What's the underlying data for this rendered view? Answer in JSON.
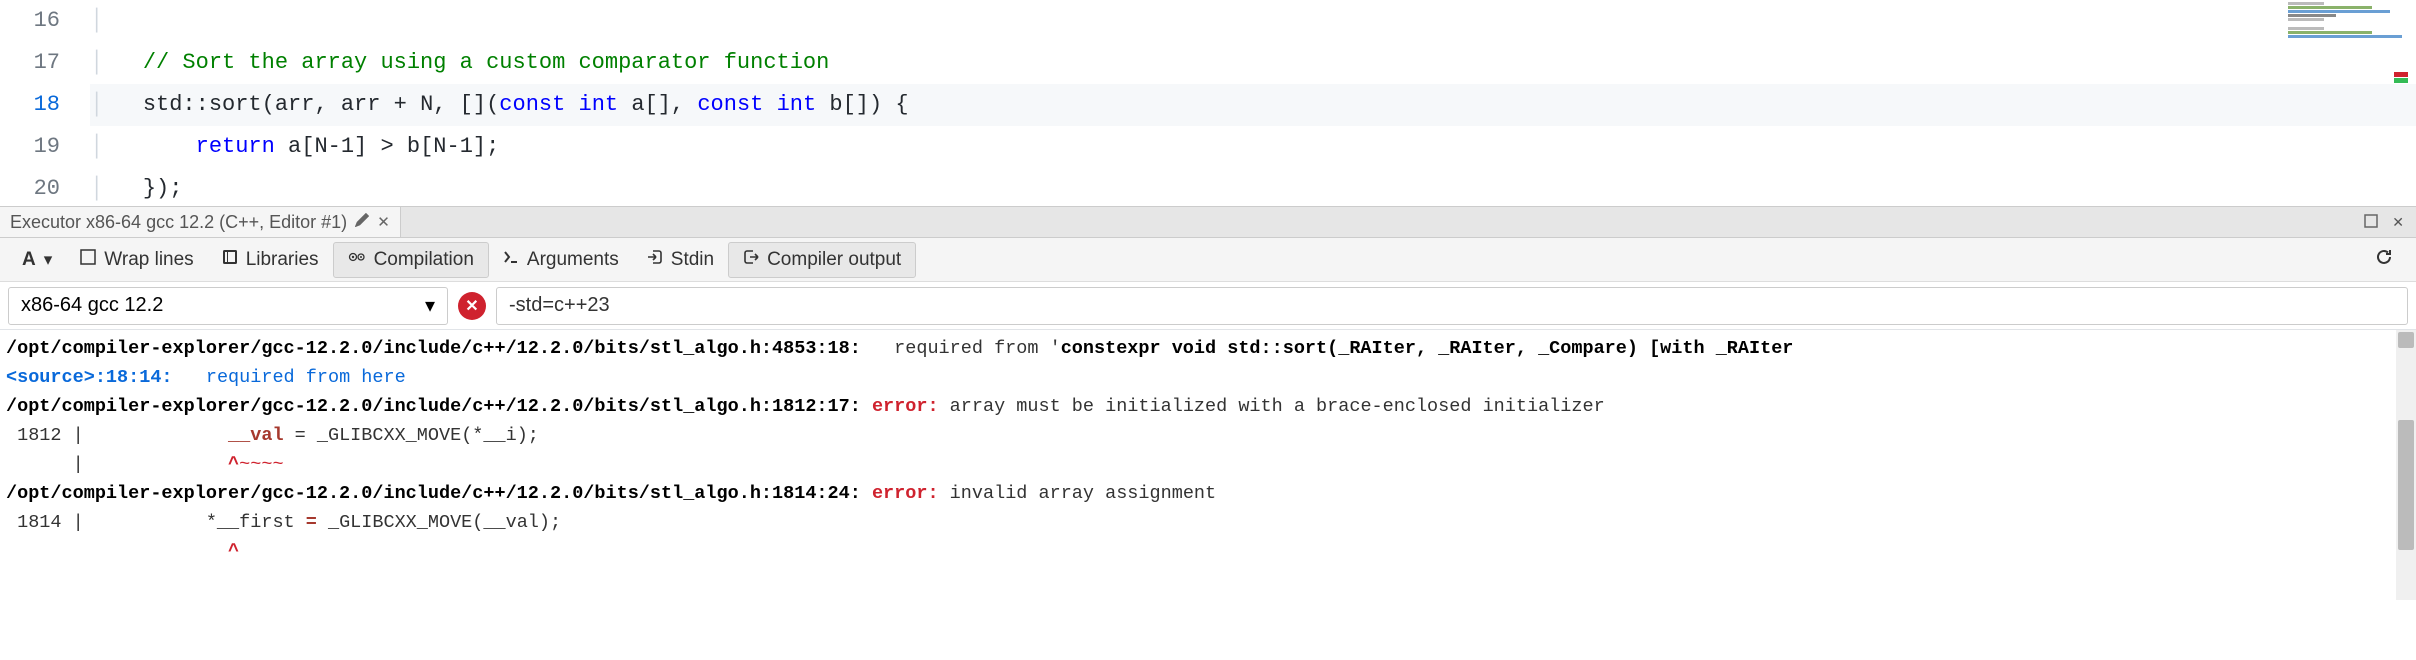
{
  "editor": {
    "line_numbers": [
      "16",
      "17",
      "18",
      "19",
      "20"
    ],
    "current_line_index": 2,
    "lines_tokens": [
      [
        {
          "t": "indent",
          "v": "│       "
        }
      ],
      [
        {
          "t": "indent",
          "v": "│   "
        },
        {
          "t": "comment",
          "v": "// Sort the array using a custom comparator function"
        }
      ],
      [
        {
          "t": "indent",
          "v": "│   "
        },
        {
          "t": "ident",
          "v": "std"
        },
        {
          "t": "punct",
          "v": "::"
        },
        {
          "t": "ident",
          "v": "sort"
        },
        {
          "t": "punct",
          "v": "("
        },
        {
          "t": "ident",
          "v": "arr"
        },
        {
          "t": "punct",
          "v": ", "
        },
        {
          "t": "ident",
          "v": "arr "
        },
        {
          "t": "punct",
          "v": "+ "
        },
        {
          "t": "ident",
          "v": "N"
        },
        {
          "t": "punct",
          "v": ", []("
        },
        {
          "t": "keyword",
          "v": "const"
        },
        {
          "t": "punct",
          "v": " "
        },
        {
          "t": "keyword",
          "v": "int"
        },
        {
          "t": "punct",
          "v": " a[], "
        },
        {
          "t": "keyword",
          "v": "const"
        },
        {
          "t": "punct",
          "v": " "
        },
        {
          "t": "keyword",
          "v": "int"
        },
        {
          "t": "punct",
          "v": " b[]) {"
        }
      ],
      [
        {
          "t": "indent",
          "v": "│       "
        },
        {
          "t": "keyword",
          "v": "return"
        },
        {
          "t": "punct",
          "v": " a[N"
        },
        {
          "t": "punct",
          "v": "-"
        },
        {
          "t": "punct",
          "v": "1] > b[N"
        },
        {
          "t": "punct",
          "v": "-"
        },
        {
          "t": "punct",
          "v": "1];"
        }
      ],
      [
        {
          "t": "indent",
          "v": "│   "
        },
        {
          "t": "punct",
          "v": "});"
        }
      ]
    ]
  },
  "panel_tab": {
    "title": "Executor x86-64 gcc 12.2 (C++, Editor #1)"
  },
  "toolbar": {
    "font_label": "A",
    "wrap_label": "Wrap lines",
    "libraries_label": "Libraries",
    "compilation_label": "Compilation",
    "arguments_label": "Arguments",
    "stdin_label": "Stdin",
    "compiler_output_label": "Compiler output"
  },
  "compiler": {
    "selected": "x86-64 gcc 12.2",
    "status_icon": "✕",
    "flags": "-std=c++23"
  },
  "output": {
    "lines": [
      {
        "segs": [
          {
            "c": "path",
            "v": "/opt/compiler-explorer/gcc-12.2.0/include/c++/12.2.0/bits/stl_algo.h:4853:18:"
          },
          {
            "c": "plain",
            "v": "   required from '"
          },
          {
            "c": "path",
            "v": "constexpr void std::sort(_RAIter, _RAIter, _Compare) [with _RAIter"
          }
        ]
      },
      {
        "segs": [
          {
            "c": "src",
            "v": "<source>:18:14:"
          },
          {
            "c": "plain",
            "v": "   "
          },
          {
            "c": "note",
            "v": "required from here"
          }
        ]
      },
      {
        "segs": [
          {
            "c": "path",
            "v": "/opt/compiler-explorer/gcc-12.2.0/include/c++/12.2.0/bits/stl_algo.h:1812:17:"
          },
          {
            "c": "plain",
            "v": " "
          },
          {
            "c": "err",
            "v": "error:"
          },
          {
            "c": "plain",
            "v": " array must be initialized with a brace-enclosed initializer"
          }
        ]
      },
      {
        "segs": [
          {
            "c": "plain",
            "v": " 1812 |             "
          },
          {
            "c": "var",
            "v": "__val"
          },
          {
            "c": "plain",
            "v": " = _GLIBCXX_MOVE(*__i);"
          }
        ]
      },
      {
        "segs": [
          {
            "c": "plain",
            "v": "      |             "
          },
          {
            "c": "caret",
            "v": "^"
          },
          {
            "c": "tilde",
            "v": "~~~~"
          }
        ]
      },
      {
        "segs": [
          {
            "c": "path",
            "v": "/opt/compiler-explorer/gcc-12.2.0/include/c++/12.2.0/bits/stl_algo.h:1814:24:"
          },
          {
            "c": "plain",
            "v": " "
          },
          {
            "c": "err",
            "v": "error:"
          },
          {
            "c": "plain",
            "v": " invalid array assignment"
          }
        ]
      },
      {
        "segs": [
          {
            "c": "plain",
            "v": " 1814 |           *__first "
          },
          {
            "c": "var",
            "v": "="
          },
          {
            "c": "plain",
            "v": " _GLIBCXX_MOVE(__val);"
          }
        ]
      },
      {
        "segs": [
          {
            "c": "plain",
            "v": "                    "
          },
          {
            "c": "caret",
            "v": "^"
          }
        ]
      }
    ]
  }
}
